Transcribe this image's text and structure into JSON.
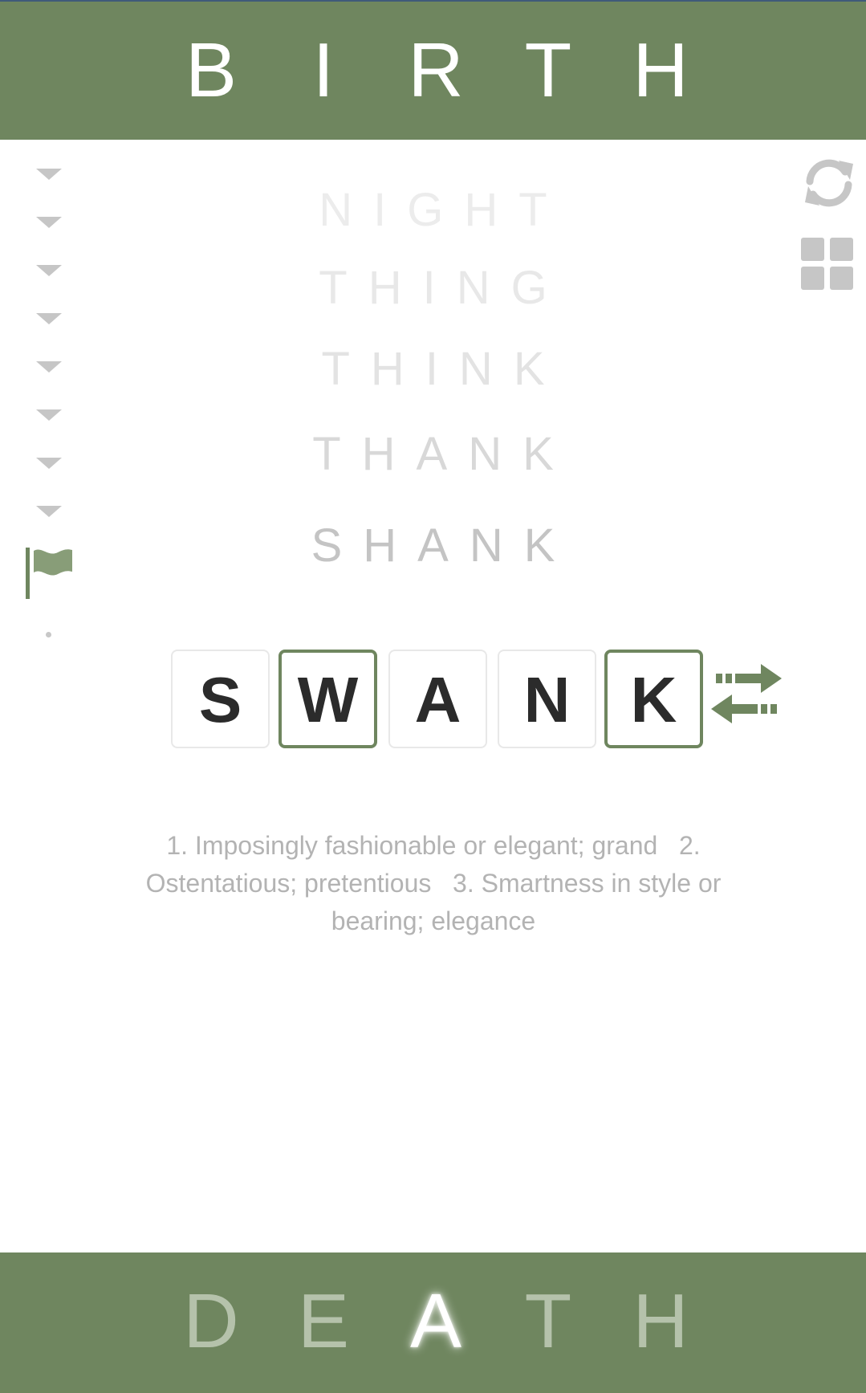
{
  "colors": {
    "accent": "#6f865f",
    "tile_text": "#2b2b2b",
    "muted": "#b3b3b3"
  },
  "start_word": {
    "letters": [
      "B",
      "I",
      "R",
      "T",
      "H"
    ]
  },
  "target_word": {
    "letters": [
      "D",
      "E",
      "A",
      "T",
      "H"
    ],
    "matched_letters": [
      false,
      false,
      true,
      false,
      false
    ]
  },
  "ladder": {
    "words": [
      "NIGHT",
      "THING",
      "THINK",
      "THANK",
      "SHANK"
    ],
    "word_colors": [
      "#ececec",
      "#e8e8e8",
      "#e3e3e3",
      "#d8d8d8",
      "#c4c4c4"
    ],
    "step_markers": 8
  },
  "current_word": {
    "letters": [
      "S",
      "W",
      "A",
      "N",
      "K"
    ],
    "highlighted": [
      false,
      true,
      false,
      false,
      true
    ]
  },
  "definition": "1. Imposingly fashionable or elegant; grand   2. Ostentatious; pretentious   3. Smartness in style or bearing; elegance",
  "icons": {
    "refresh": "refresh-icon",
    "grid": "grid-icon",
    "swap": "swap-arrows-icon",
    "flag": "flag-icon",
    "step": "caret-down-icon"
  }
}
